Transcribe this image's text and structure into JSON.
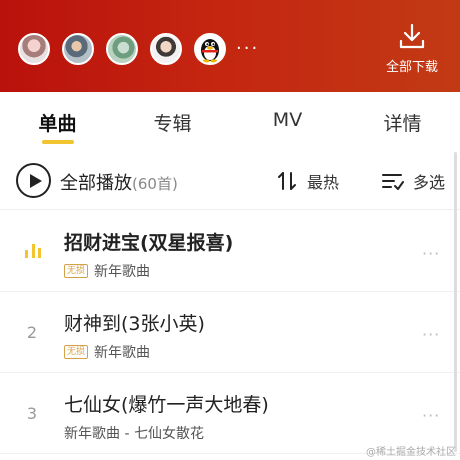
{
  "header": {
    "avatars": [
      {
        "name": "avatar-1"
      },
      {
        "name": "avatar-2"
      },
      {
        "name": "avatar-3"
      },
      {
        "name": "avatar-4"
      },
      {
        "name": "avatar-qq"
      }
    ],
    "more": "···",
    "download_label": "全部下载",
    "download_icon": "download-icon"
  },
  "tabs": [
    {
      "label": "单曲",
      "active": true
    },
    {
      "label": "专辑",
      "active": false
    },
    {
      "label": "MV",
      "active": false
    },
    {
      "label": "详情",
      "active": false
    }
  ],
  "playbar": {
    "play_all_label": "全部播放",
    "count": "(60首)",
    "sort_label": "最热",
    "multi_select_label": "多选"
  },
  "songs": [
    {
      "index": "",
      "playing": true,
      "title": "招财进宝(双星报喜)",
      "badge": "无损",
      "meta": "新年歌曲"
    },
    {
      "index": "2",
      "playing": false,
      "title": "财神到(3张小英)",
      "badge": "无损",
      "meta": "新年歌曲"
    },
    {
      "index": "3",
      "playing": false,
      "title": "七仙女(爆竹一声大地春)",
      "badge": "",
      "meta": "新年歌曲 - 七仙女散花"
    }
  ],
  "row_more": "···",
  "watermark": "@稀土掘金技术社区",
  "colors": {
    "header_red": "#c42510",
    "accent_yellow": "#f2c430"
  }
}
